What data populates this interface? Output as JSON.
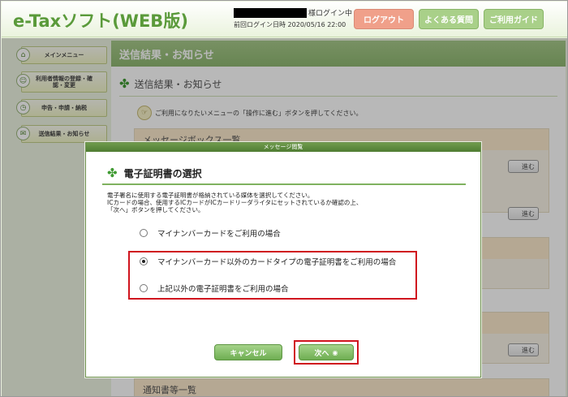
{
  "header": {
    "logo": "e-Taxソフト(WEB版)",
    "login_suffix": "様ログイン中",
    "last_login_label": "前回ログイン日時",
    "last_login_value": "2020/05/16 22:00",
    "logout_label": "ログアウト",
    "faq_label": "よくある質問",
    "guide_label": "ご利用ガイド"
  },
  "sidebar": {
    "items": [
      {
        "label": "メインメニュー",
        "icon": "home-icon"
      },
      {
        "label": "利用者情報の登録・確認・変更",
        "icon": "user-icon"
      },
      {
        "label": "申告・申請・納税",
        "icon": "clock-icon"
      },
      {
        "label": "送信結果・お知らせ",
        "icon": "mail-icon"
      }
    ]
  },
  "main": {
    "title": "送信結果・お知らせ",
    "section_title": "送信結果・お知らせ",
    "hint": "ご利用になりたいメニューの「操作に進む」ボタンを押してください。",
    "panels": [
      {
        "heading": "メッセージボックス一覧",
        "button": "進む"
      },
      {
        "heading": "",
        "button": "進む"
      },
      {
        "heading": "",
        "button": "進む"
      },
      {
        "heading": "通知書等一覧",
        "button": ""
      }
    ]
  },
  "modal": {
    "titlebar": "メッセージ閲覧",
    "heading": "電子証明書の選択",
    "desc_lines": [
      "電子署名に使用する電子証明書が格納されている媒体を選択してください。",
      "ICカードの場合、使用するICカードがICカードリーダライタにセットされているか確認の上、",
      "「次へ」ボタンを押してください。"
    ],
    "options": [
      {
        "label": "マイナンバーカードをご利用の場合",
        "checked": false
      },
      {
        "label": "マイナンバーカード以外のカードタイプの電子証明書をご利用の場合",
        "checked": true
      },
      {
        "label": "上記以外の電子証明書をご利用の場合",
        "checked": false
      }
    ],
    "cancel_label": "キャンセル",
    "next_label": "次へ",
    "next_arrow": "◉"
  },
  "colors": {
    "accent_green": "#8fb872",
    "highlight_red": "#d0141e",
    "logout_salmon": "#f0a08a"
  }
}
